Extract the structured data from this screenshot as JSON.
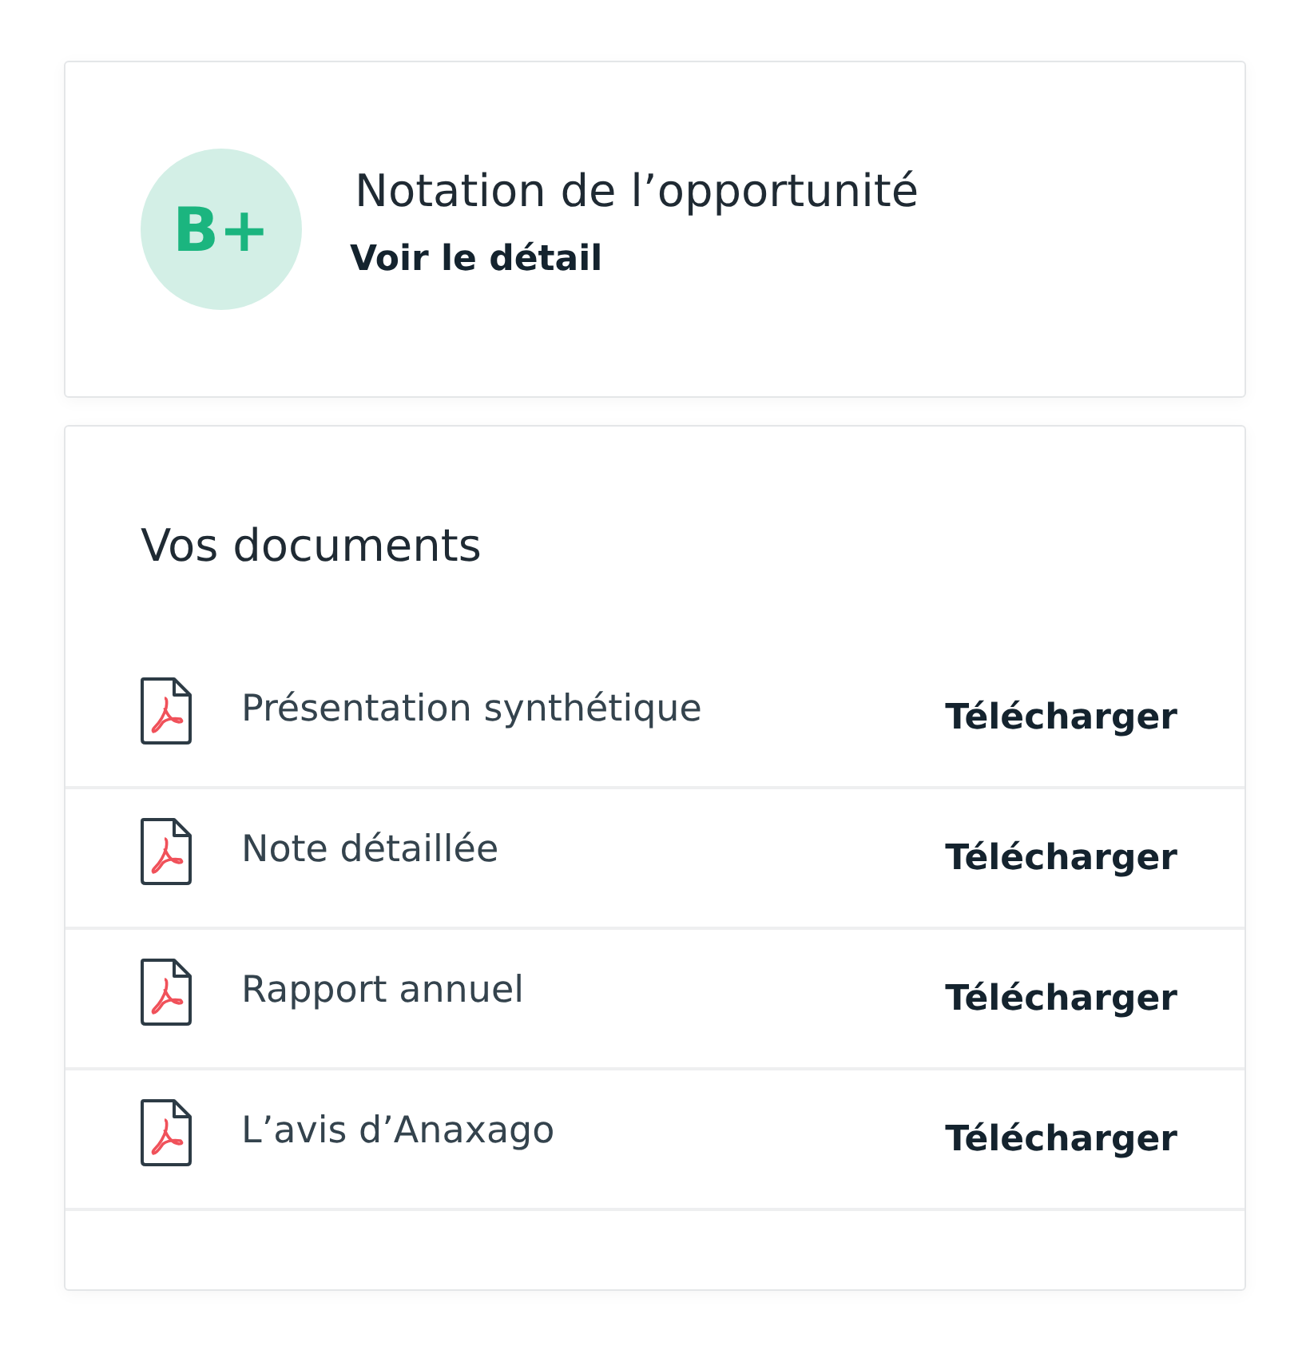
{
  "rating": {
    "grade": "B+",
    "title": "Notation de l’opportunité",
    "link": "Voir le détail"
  },
  "documents": {
    "title": "Vos documents",
    "items": [
      {
        "name": "Présentation synthétique",
        "action": "Télécharger"
      },
      {
        "name": "Note détaillée",
        "action": "Télécharger"
      },
      {
        "name": "Rapport annuel",
        "action": "Télécharger"
      },
      {
        "name": "L’avis d’Anaxago",
        "action": "Télécharger"
      }
    ]
  }
}
